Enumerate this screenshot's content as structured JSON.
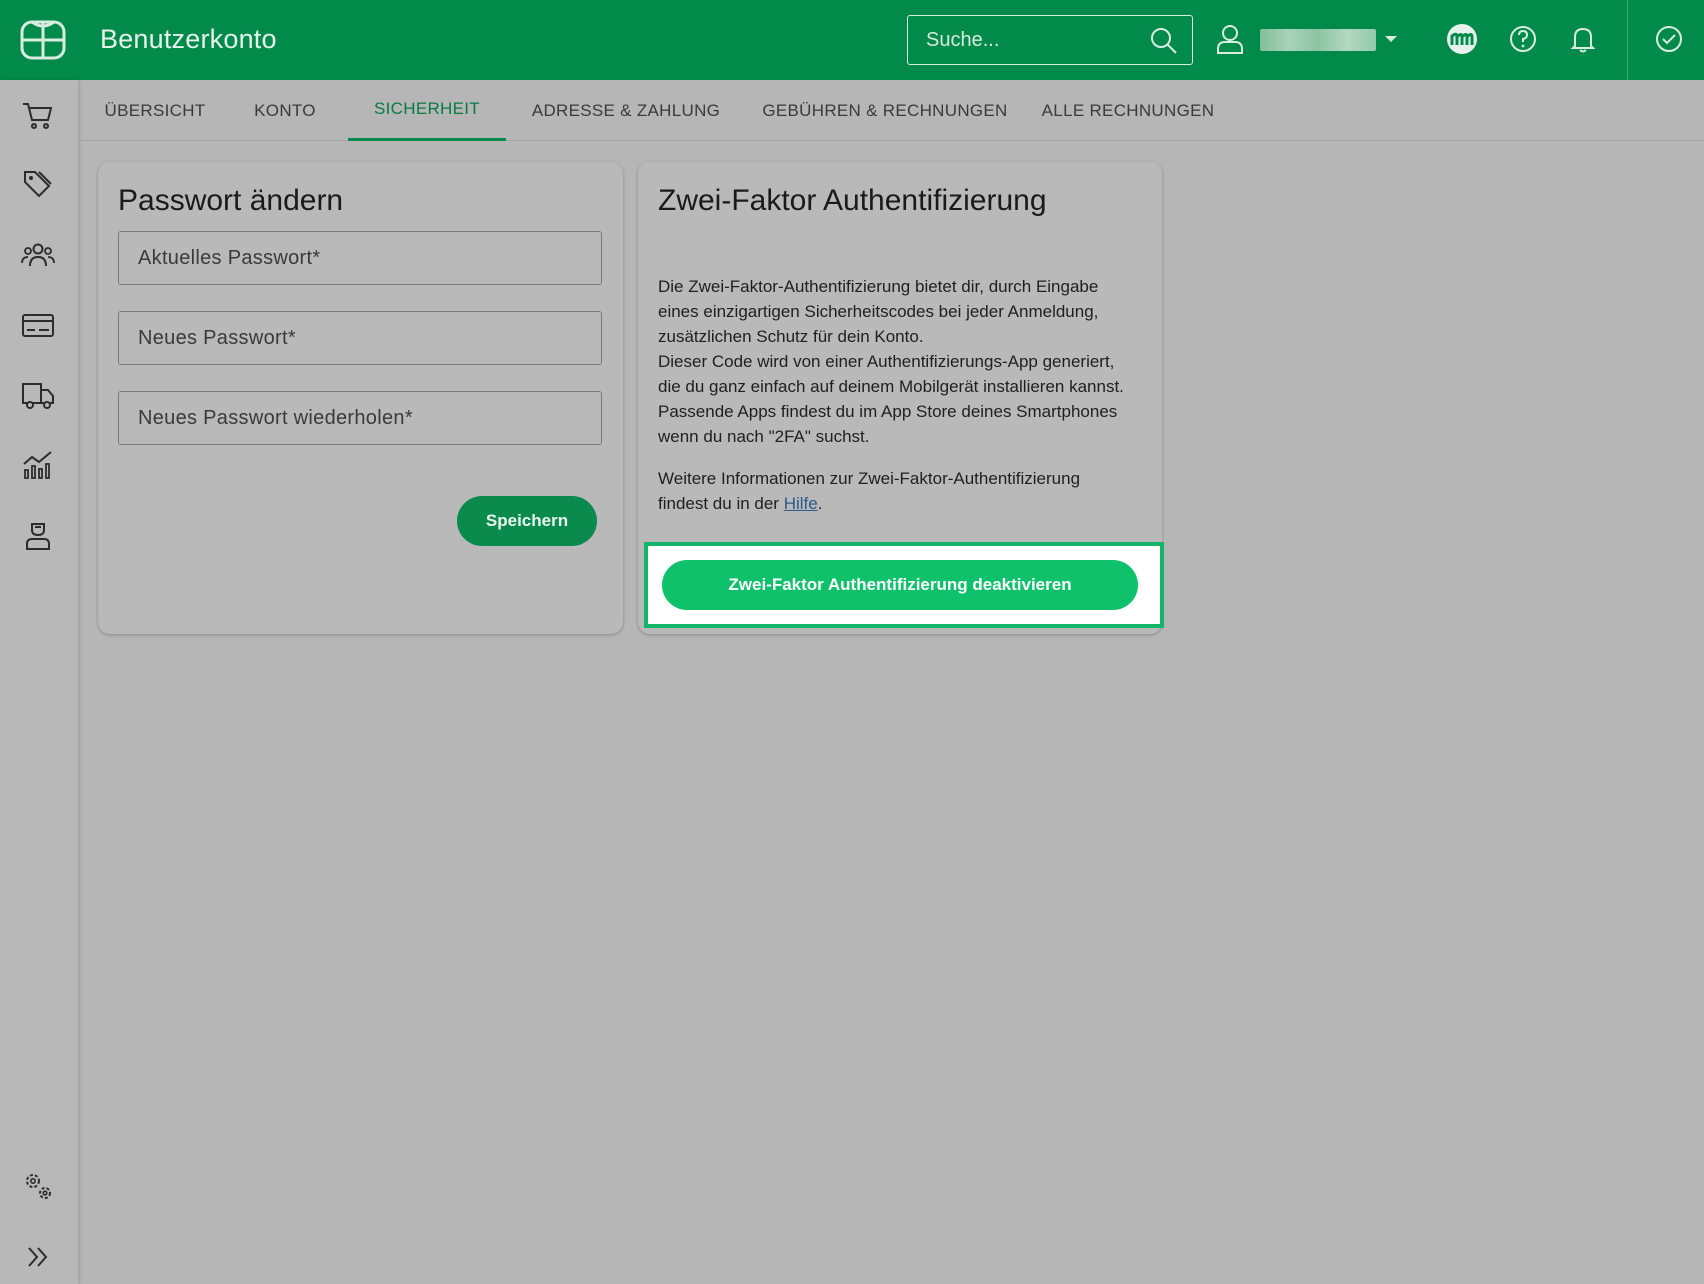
{
  "app": {
    "title": "Benutzerkonto",
    "logo_icon": "logo-icon",
    "brand_color": "#028a4b"
  },
  "search": {
    "placeholder": "Suche...",
    "icon": "search-icon"
  },
  "topbar_icons": [
    "user-icon",
    "dropdown-caret-icon",
    "partner-logo-icon",
    "help-icon",
    "bell-icon",
    "check-circle-icon"
  ],
  "sidebar": {
    "items": [
      "cart-icon",
      "tags-icon",
      "users-icon",
      "credit-card-icon",
      "truck-icon",
      "chart-icon",
      "support-agent-icon"
    ],
    "bottom": [
      "settings-icon",
      "expand-icon"
    ]
  },
  "tabs": [
    {
      "label": "ÜBERSICHT",
      "active": false
    },
    {
      "label": "KONTO",
      "active": false
    },
    {
      "label": "SICHERHEIT",
      "active": true
    },
    {
      "label": "ADRESSE & ZAHLUNG",
      "active": false
    },
    {
      "label": "GEBÜHREN & RECHNUNGEN",
      "active": false
    },
    {
      "label": "ALLE RECHNUNGEN",
      "active": false
    }
  ],
  "password_card": {
    "title": "Passwort ändern",
    "fields": [
      {
        "placeholder": "Aktuelles Passwort*"
      },
      {
        "placeholder": "Neues Passwort*"
      },
      {
        "placeholder": "Neues Passwort wiederholen*"
      }
    ],
    "save_label": "Speichern"
  },
  "twofa_card": {
    "title": "Zwei-Faktor Authentifizierung",
    "paragraph1_lines": [
      "Die Zwei-Faktor-Authentifizierung bietet dir, durch Eingabe",
      "eines einzigartigen Sicherheitscodes bei jeder Anmeldung,",
      "zusätzlichen Schutz für dein Konto.",
      "Dieser Code wird von einer Authentifizierungs-App generiert,",
      "die du ganz einfach auf deinem Mobilgerät installieren kannst.",
      "Passende Apps findest du im App Store deines Smartphones",
      "wenn du nach \"2FA\" suchst."
    ],
    "paragraph2_line1": "Weitere Informationen zur Zwei-Faktor-Authentifizierung",
    "paragraph2_prefix": "findest du in der ",
    "help_link": "Hilfe",
    "paragraph2_suffix": ".",
    "deactivate_label": "Zwei-Faktor Authentifizierung deaktivieren",
    "highlight_color": "#12b56a"
  }
}
